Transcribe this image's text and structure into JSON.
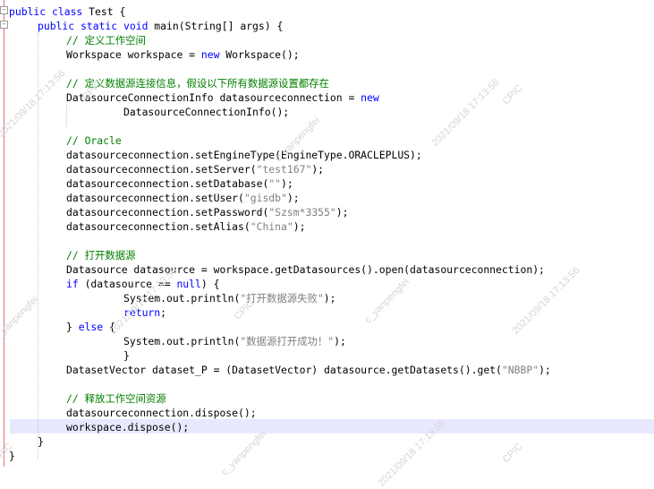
{
  "code_lines": [
    {
      "indent": 0,
      "tokens": [
        {
          "k": "kw",
          "t": "public class"
        },
        {
          "k": "p",
          "t": " Test {"
        }
      ]
    },
    {
      "indent": 1,
      "tokens": [
        {
          "k": "kw",
          "t": "public static void"
        },
        {
          "k": "p",
          "t": " main(String[] args) {"
        }
      ]
    },
    {
      "indent": 2,
      "tokens": [
        {
          "k": "cm",
          "t": "// 定义工作空间"
        }
      ]
    },
    {
      "indent": 2,
      "tokens": [
        {
          "k": "p",
          "t": "Workspace workspace = "
        },
        {
          "k": "kw",
          "t": "new"
        },
        {
          "k": "p",
          "t": " Workspace();"
        }
      ]
    },
    {
      "indent": 0,
      "tokens": []
    },
    {
      "indent": 2,
      "tokens": [
        {
          "k": "cm",
          "t": "// 定义数据源连接信息，假设以下所有数据源设置都存在"
        }
      ]
    },
    {
      "indent": 2,
      "tokens": [
        {
          "k": "p",
          "t": "DatasourceConnectionInfo datasourceconnection = "
        },
        {
          "k": "kw",
          "t": "new"
        }
      ]
    },
    {
      "indent": 4,
      "tokens": [
        {
          "k": "p",
          "t": "DatasourceConnectionInfo();"
        }
      ]
    },
    {
      "indent": 0,
      "tokens": []
    },
    {
      "indent": 2,
      "tokens": [
        {
          "k": "cm",
          "t": "// Oracle"
        }
      ]
    },
    {
      "indent": 2,
      "tokens": [
        {
          "k": "p",
          "t": "datasourceconnection.setEngineType(EngineType.ORACLEPLUS);"
        }
      ]
    },
    {
      "indent": 2,
      "tokens": [
        {
          "k": "p",
          "t": "datasourceconnection.setServer("
        },
        {
          "k": "st",
          "t": "\"test167\""
        },
        {
          "k": "p",
          "t": ");"
        }
      ]
    },
    {
      "indent": 2,
      "tokens": [
        {
          "k": "p",
          "t": "datasourceconnection.setDatabase("
        },
        {
          "k": "st",
          "t": "\"\""
        },
        {
          "k": "p",
          "t": ");"
        }
      ]
    },
    {
      "indent": 2,
      "tokens": [
        {
          "k": "p",
          "t": "datasourceconnection.setUser("
        },
        {
          "k": "st",
          "t": "\"gisdb\""
        },
        {
          "k": "p",
          "t": ");"
        }
      ]
    },
    {
      "indent": 2,
      "tokens": [
        {
          "k": "p",
          "t": "datasourceconnection.setPassword("
        },
        {
          "k": "st",
          "t": "\"Szsm*3355\""
        },
        {
          "k": "p",
          "t": ");"
        }
      ]
    },
    {
      "indent": 2,
      "tokens": [
        {
          "k": "p",
          "t": "datasourceconnection.setAlias("
        },
        {
          "k": "st",
          "t": "\"China\""
        },
        {
          "k": "p",
          "t": ");"
        }
      ]
    },
    {
      "indent": 0,
      "tokens": []
    },
    {
      "indent": 2,
      "tokens": [
        {
          "k": "cm",
          "t": "// 打开数据源"
        }
      ]
    },
    {
      "indent": 2,
      "tokens": [
        {
          "k": "p",
          "t": "Datasource datasource = workspace.getDatasources().open(datasourceconnection);"
        }
      ]
    },
    {
      "indent": 2,
      "tokens": [
        {
          "k": "kw",
          "t": "if"
        },
        {
          "k": "p",
          "t": " (datasource == "
        },
        {
          "k": "kw",
          "t": "null"
        },
        {
          "k": "p",
          "t": ") {"
        }
      ]
    },
    {
      "indent": 4,
      "tokens": [
        {
          "k": "p",
          "t": "System.out.println("
        },
        {
          "k": "st",
          "t": "\"打开数据源失败\""
        },
        {
          "k": "p",
          "t": ");"
        }
      ]
    },
    {
      "indent": 4,
      "tokens": [
        {
          "k": "kw",
          "t": "return"
        },
        {
          "k": "p",
          "t": ";"
        }
      ]
    },
    {
      "indent": 2,
      "tokens": [
        {
          "k": "p",
          "t": "} "
        },
        {
          "k": "kw",
          "t": "else"
        },
        {
          "k": "p",
          "t": " {"
        }
      ]
    },
    {
      "indent": 4,
      "tokens": [
        {
          "k": "p",
          "t": "System.out.println("
        },
        {
          "k": "st",
          "t": "\"数据源打开成功！\""
        },
        {
          "k": "p",
          "t": ");"
        }
      ]
    },
    {
      "indent": 4,
      "tokens": [
        {
          "k": "p",
          "t": "}"
        }
      ]
    },
    {
      "indent": 2,
      "tokens": [
        {
          "k": "p",
          "t": "DatasetVector dataset_P = (DatasetVector) datasource.getDatasets().get("
        },
        {
          "k": "st",
          "t": "\"NBBP\""
        },
        {
          "k": "p",
          "t": ");"
        }
      ]
    },
    {
      "indent": 0,
      "tokens": []
    },
    {
      "indent": 2,
      "tokens": [
        {
          "k": "cm",
          "t": "// 释放工作空间资源"
        }
      ]
    },
    {
      "indent": 2,
      "tokens": [
        {
          "k": "p",
          "t": "datasourceconnection.dispose();"
        }
      ]
    },
    {
      "indent": 2,
      "tokens": [
        {
          "k": "p",
          "t": "workspace.dispose();"
        }
      ]
    },
    {
      "indent": 1,
      "tokens": [
        {
          "k": "p",
          "t": "}"
        }
      ]
    },
    {
      "indent": 0,
      "tokens": [
        {
          "k": "p",
          "t": "}"
        }
      ]
    }
  ],
  "watermark": {
    "user": "c_yanpengfei",
    "org": "CPIC",
    "timestamp": "2021/09/18 17:13:56"
  },
  "colors": {
    "keyword": "#0000ff",
    "comment": "#008000",
    "string": "#808080",
    "current_line": "#e8e8ff"
  }
}
